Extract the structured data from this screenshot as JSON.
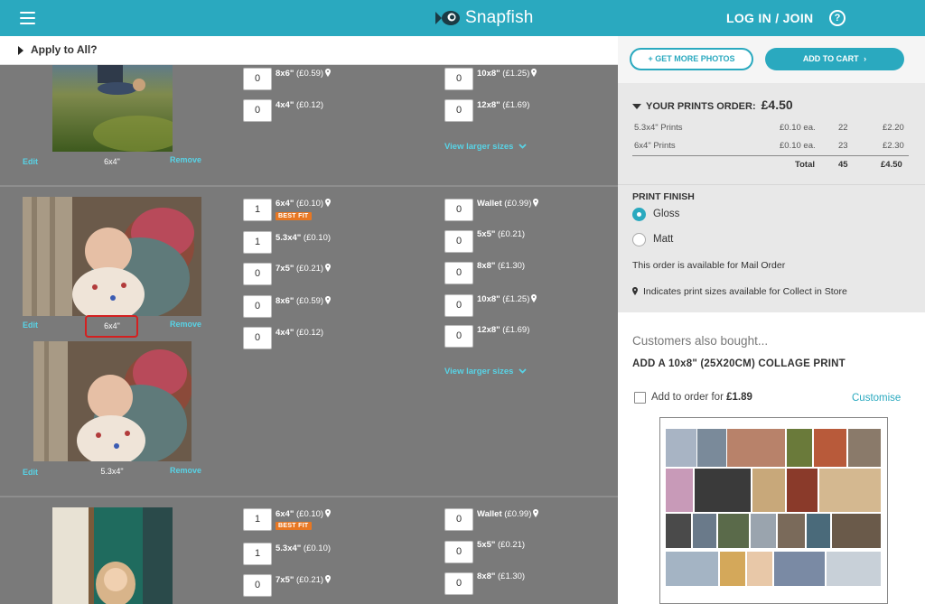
{
  "header": {
    "brand": "Snapfish",
    "login_label": "LOG IN / JOIN",
    "help_label": "?",
    "color": "#2aa9bf"
  },
  "apply_bar": {
    "label": "Apply to All?"
  },
  "photos": [
    {
      "edit": "Edit",
      "remove": "Remove",
      "size": "6x4\""
    },
    {
      "edit": "Edit",
      "remove": "Remove",
      "size": "6x4\""
    },
    {
      "edit": "Edit",
      "remove": "Remove",
      "size": "5.3x4\""
    }
  ],
  "groups": [
    {
      "left": [
        {
          "qty": "0",
          "size": "8x6\"",
          "price": "(£0.59)",
          "pin": true
        },
        {
          "qty": "0",
          "size": "4x4\"",
          "price": "(£0.12)",
          "pin": false
        }
      ],
      "right": [
        {
          "qty": "0",
          "size": "10x8\"",
          "price": "(£1.25)",
          "pin": true
        },
        {
          "qty": "0",
          "size": "12x8\"",
          "price": "(£1.69)",
          "pin": false
        }
      ],
      "view_larger": "View larger sizes"
    },
    {
      "left": [
        {
          "qty": "1",
          "size": "6x4\"",
          "price": "(£0.10)",
          "pin": true,
          "badge": "BEST FIT"
        },
        {
          "qty": "1",
          "size": "5.3x4\"",
          "price": "(£0.10)",
          "pin": false
        },
        {
          "qty": "0",
          "size": "7x5\"",
          "price": "(£0.21)",
          "pin": true
        },
        {
          "qty": "0",
          "size": "8x6\"",
          "price": "(£0.59)",
          "pin": true
        },
        {
          "qty": "0",
          "size": "4x4\"",
          "price": "(£0.12)",
          "pin": false
        }
      ],
      "right": [
        {
          "qty": "0",
          "size": "Wallet",
          "price": "(£0.99)",
          "pin": true
        },
        {
          "qty": "0",
          "size": "5x5\"",
          "price": "(£0.21)",
          "pin": false
        },
        {
          "qty": "0",
          "size": "8x8\"",
          "price": "(£1.30)",
          "pin": false
        },
        {
          "qty": "0",
          "size": "10x8\"",
          "price": "(£1.25)",
          "pin": true
        },
        {
          "qty": "0",
          "size": "12x8\"",
          "price": "(£1.69)",
          "pin": false
        }
      ],
      "view_larger": "View larger sizes"
    },
    {
      "left": [
        {
          "qty": "1",
          "size": "6x4\"",
          "price": "(£0.10)",
          "pin": true,
          "badge": "BEST FIT"
        },
        {
          "qty": "1",
          "size": "5.3x4\"",
          "price": "(£0.10)",
          "pin": false
        },
        {
          "qty": "0",
          "size": "7x5\"",
          "price": "(£0.21)",
          "pin": true
        }
      ],
      "right": [
        {
          "qty": "0",
          "size": "Wallet",
          "price": "(£0.99)",
          "pin": true
        },
        {
          "qty": "0",
          "size": "5x5\"",
          "price": "(£0.21)",
          "pin": false
        },
        {
          "qty": "0",
          "size": "8x8\"",
          "price": "(£1.30)",
          "pin": false
        }
      ]
    }
  ],
  "sidebar": {
    "get_more_label": "+ GET MORE PHOTOS",
    "add_cart_label": "ADD TO CART",
    "order": {
      "title": "YOUR PRINTS ORDER:",
      "total": "£4.50",
      "rows": [
        {
          "name": "5.3x4\" Prints",
          "each": "£0.10 ea.",
          "qty": "22",
          "price": "£2.20"
        },
        {
          "name": "6x4\" Prints",
          "each": "£0.10 ea.",
          "qty": "23",
          "price": "£2.30"
        }
      ],
      "total_label": "Total",
      "total_qty": "45",
      "total_price": "£4.50"
    },
    "finish": {
      "title": "PRINT FINISH",
      "options": [
        "Gloss",
        "Matt"
      ],
      "selected": "Gloss",
      "mail_info": "This order is available for Mail Order",
      "store_info": "Indicates print sizes available for Collect in Store"
    },
    "also": {
      "title": "Customers also bought...",
      "collage_title": "ADD A 10x8\" (25X20CM) COLLAGE PRINT",
      "add_label": "Add to order for",
      "add_price": "£1.89",
      "customise": "Customise"
    }
  }
}
